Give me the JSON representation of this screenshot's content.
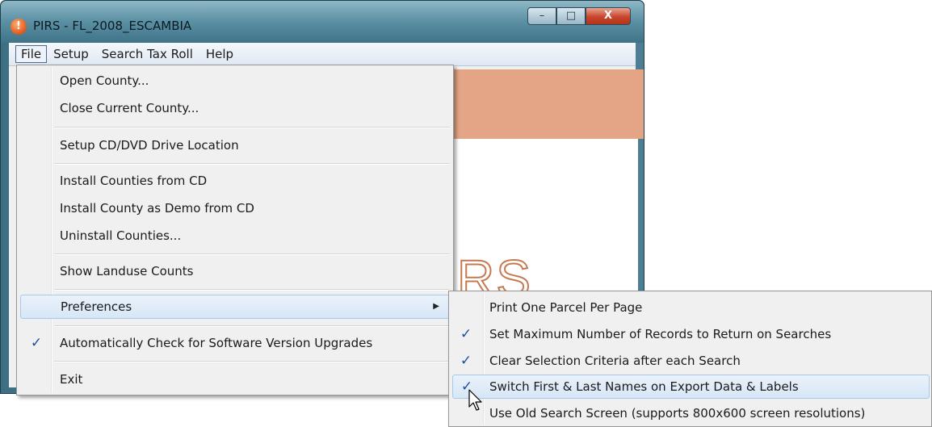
{
  "window": {
    "title": "PIRS - FL_2008_ESCAMBIA",
    "icon": "info-icon",
    "caption_buttons": {
      "minimize": "–",
      "maximize": "□",
      "close": "X"
    }
  },
  "menubar": {
    "items": [
      "File",
      "Setup",
      "Search Tax Roll",
      "Help"
    ]
  },
  "background": {
    "logo_text": "RS",
    "banner_color": "#e3a585"
  },
  "file_menu": {
    "items": [
      {
        "label": "Open County..."
      },
      {
        "label": "Close Current County..."
      },
      {
        "label": "Setup CD/DVD Drive Location"
      },
      {
        "label": "Install Counties from CD"
      },
      {
        "label": "Install County as Demo from CD"
      },
      {
        "label": "Uninstall Counties..."
      },
      {
        "label": "Show Landuse Counts"
      },
      {
        "label": "Preferences",
        "submenu_arrow": "▶"
      },
      {
        "label": "Automatically Check for Software Version Upgrades",
        "check": "✓"
      },
      {
        "label": "Exit"
      }
    ]
  },
  "preferences_menu": {
    "items": [
      {
        "label": "Print One Parcel Per Page"
      },
      {
        "label": "Set Maximum Number of Records to Return on Searches",
        "check": "✓"
      },
      {
        "label": "Clear Selection Criteria after each Search",
        "check": "✓"
      },
      {
        "label": "Switch First & Last Names on Export Data & Labels",
        "check": "✓"
      },
      {
        "label": "Use Old Search Screen (supports 800x600 screen resolutions)"
      }
    ]
  },
  "colors": {
    "hover_bg": "#d7e6f6",
    "check": "#1b4fa0"
  }
}
